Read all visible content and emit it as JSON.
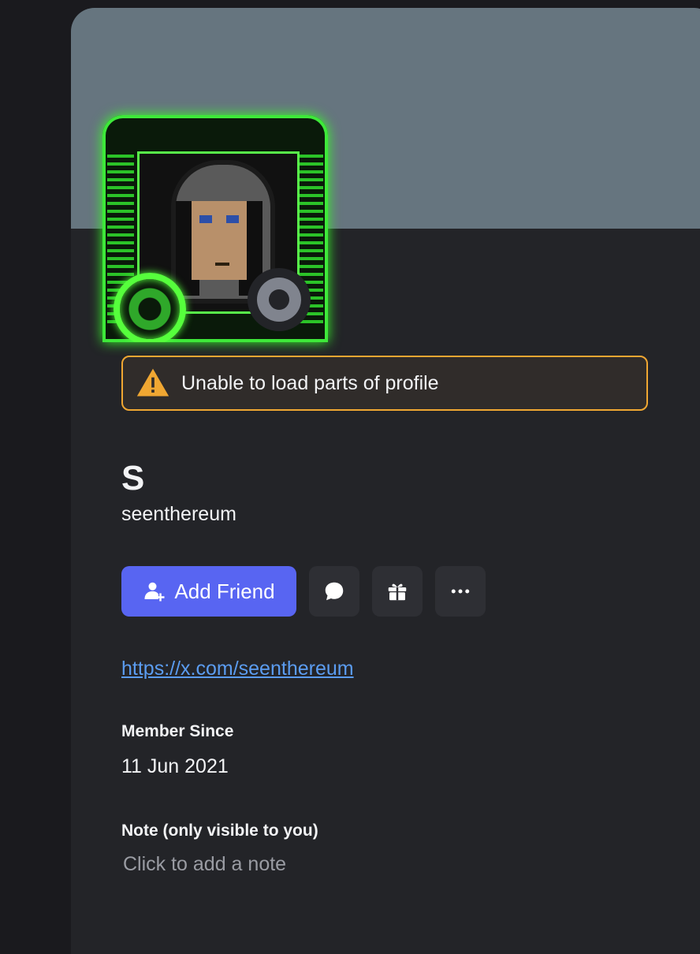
{
  "profile": {
    "warning": "Unable to load parts of profile",
    "display_name": "S",
    "username": "seenthereum",
    "status": "offline"
  },
  "actions": {
    "add_friend_label": "Add Friend",
    "icons": [
      "message-icon",
      "gift-icon",
      "more-icon"
    ]
  },
  "link": "https://x.com/seenthereum",
  "member_since": {
    "label": "Member Since",
    "value": "11 Jun 2021"
  },
  "note": {
    "label": "Note (only visible to you)",
    "placeholder": "Click to add a note"
  },
  "colors": {
    "banner": "#66757f",
    "card": "#232428",
    "accent": "#5865f2",
    "warning_border": "#f0a732",
    "link": "#5b9cf0"
  }
}
